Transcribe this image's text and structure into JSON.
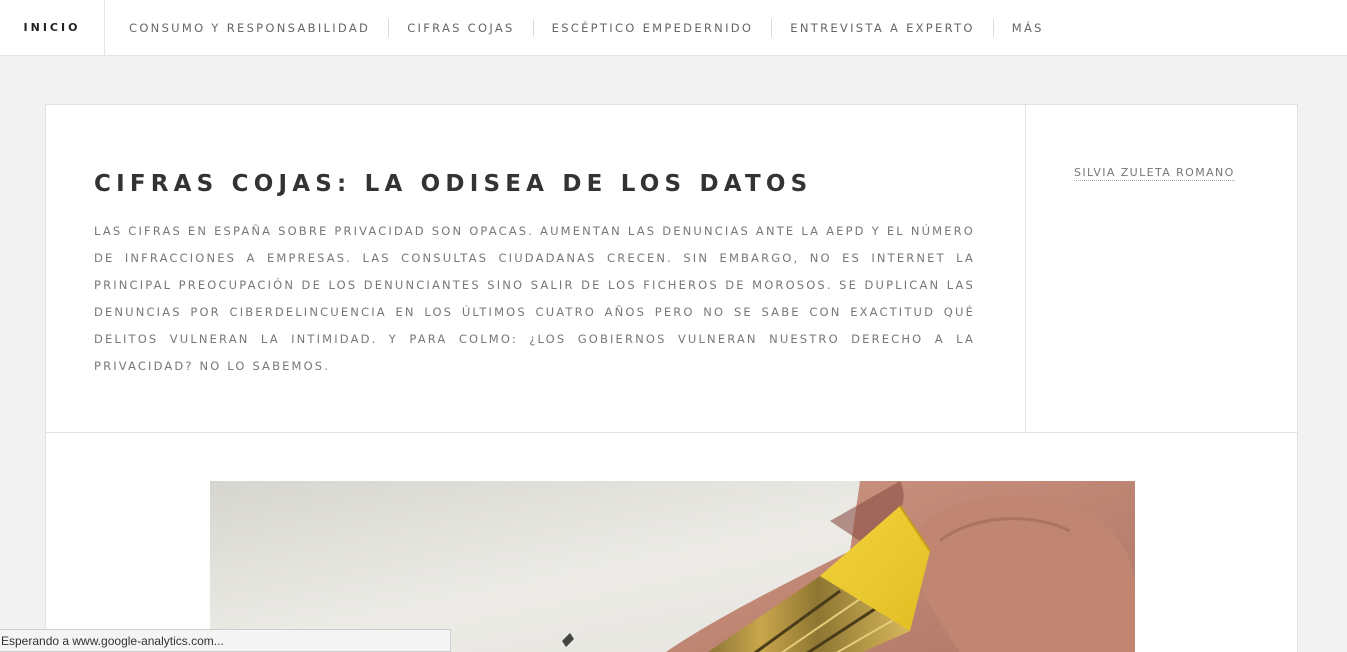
{
  "nav": {
    "home": "INICIO",
    "items": [
      "CONSUMO Y RESPONSABILIDAD",
      "CIFRAS COJAS",
      "ESCÉPTICO EMPEDERNIDO",
      "ENTREVISTA A EXPERTO",
      "MÁS"
    ]
  },
  "post": {
    "title": "CIFRAS COJAS: LA ODISEA DE LOS DATOS",
    "lead": "LAS CIFRAS EN ESPAÑA SOBRE PRIVACIDAD SON OPACAS. AUMENTAN LAS DENUNCIAS ANTE LA AEPD Y EL NÚMERO DE INFRACCIONES A EMPRESAS. LAS CONSULTAS CIUDADANAS CRECEN. SIN EMBARGO, NO ES INTERNET LA PRINCIPAL PREOCUPACIÓN DE LOS DENUNCIANTES SINO SALIR DE LOS FICHEROS DE MOROSOS. SE DUPLICAN LAS DENUNCIAS POR CIBERDELINCUENCIA EN LOS ÚLTIMOS CUATRO AÑOS PERO NO SE SABE CON EXACTITUD QUÉ DELITOS VULNERAN LA INTIMIDAD. Y PARA COLMO: ¿LOS GOBIERNOS VULNERAN NUESTRO DERECHO A LA PRIVACIDAD? NO LO SABEMOS.",
    "author": "SILVIA ZULETA ROMANO",
    "image_icon": "pencil-eraser-photo"
  },
  "status": {
    "text": "Esperando a www.google-analytics.com..."
  },
  "colors": {
    "background": "#f2f2f2",
    "card": "#ffffff",
    "title": "#333333",
    "muted": "#777777"
  }
}
